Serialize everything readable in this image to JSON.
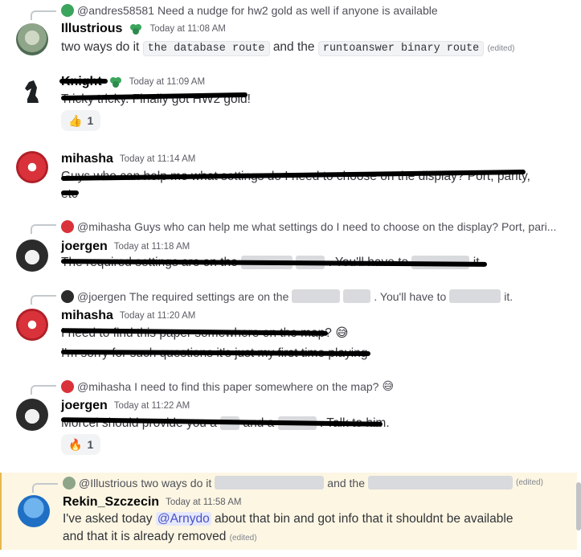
{
  "messages": [
    {
      "reply": {
        "author": "@andres58581",
        "text": "Need a nudge for hw2 gold as well if anyone is available"
      },
      "author": "Illustrious",
      "time": "Today at 11:08 AM",
      "content": {
        "pre": "two ways do it",
        "code1": "the database route",
        "mid": "and the",
        "code2": "runtoanswer binary route",
        "edited": "(edited)"
      }
    },
    {
      "author": "Knight",
      "time": "Today at 11:09 AM",
      "content": {
        "text": "Tricky tricky. Finally got HW2 gold!"
      },
      "reaction": {
        "emoji": "👍",
        "count": "1"
      }
    },
    {
      "author": "mihasha",
      "time": "Today at 11:14 AM",
      "content": {
        "line1": "Guys who can help me what settings do I need to choose on the display? Port, parity,",
        "line2": "etc"
      }
    },
    {
      "reply": {
        "author": "@mihasha",
        "text": "Guys who can help me what settings do I need to choose on the display? Port, pari..."
      },
      "author": "joergen",
      "time": "Today at 11:18 AM",
      "content": {
        "pre": "The required settings are on the",
        "mid": ". You'll have to",
        "post": "it."
      }
    },
    {
      "reply": {
        "author": "@joergen",
        "pre": "The required settings are on the",
        "mid": ". You'll have to",
        "post": "it."
      },
      "author": "mihasha",
      "time": "Today at 11:20 AM",
      "content": {
        "line1": "I need to find this paper somewhere on the map?",
        "emoji1": "😅",
        "line2": "I'm sorry for such questions it's just my first time playing"
      }
    },
    {
      "reply": {
        "author": "@mihasha",
        "text": "I need to find this paper somewhere on the map?",
        "emoji": "😅"
      },
      "author": "joergen",
      "time": "Today at 11:22 AM",
      "content": {
        "pre": "Morcel should provide you a",
        "mid": "and a",
        "post": ". Talk to him."
      },
      "reaction": {
        "emoji": "🔥",
        "count": "1"
      }
    },
    {
      "reply": {
        "author": "@Illustrious",
        "pre": "two ways do it",
        "mid": "and the",
        "edited": "(edited)"
      },
      "author": "Rekin_Szczecin",
      "time": "Today at 11:58 AM",
      "content": {
        "pre": "I've asked today",
        "mention": "@Arnydo",
        "mid": "about that bin and got info that it shouldnt be available",
        "line2": "and that it is already removed",
        "edited": "(edited)"
      }
    }
  ],
  "colors": {
    "accent": "#5865f2",
    "highlight_bg": "#fdf6e3",
    "spoiler": "#d8dadd",
    "role_badge": "#3ba55d"
  }
}
